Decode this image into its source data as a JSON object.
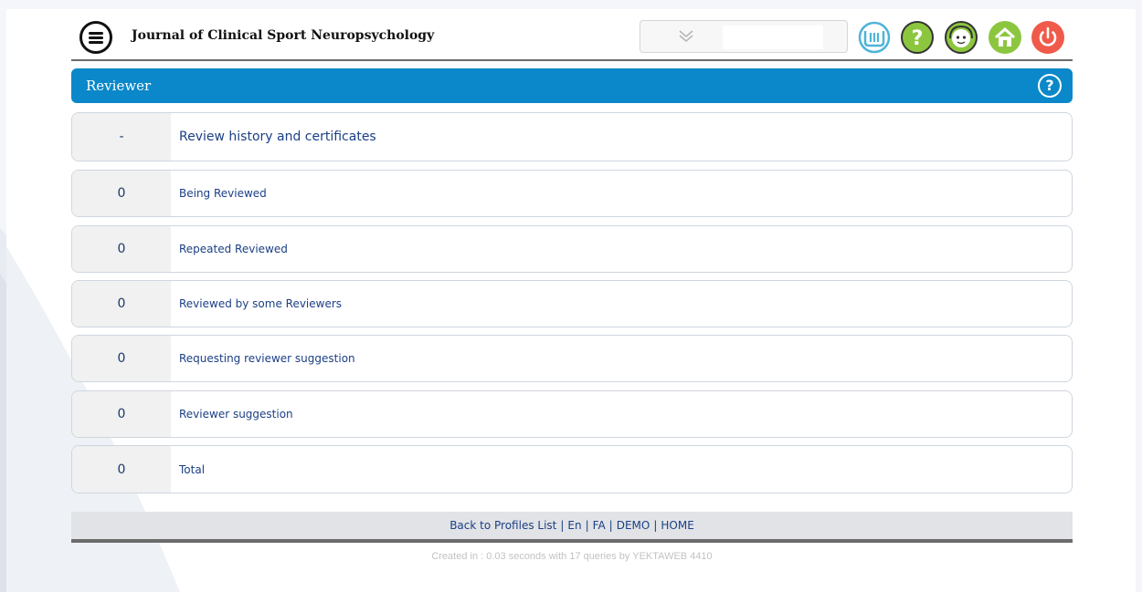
{
  "header": {
    "journal_title": "Journal of Clinical Sport Neuropsychology",
    "icons": [
      "menu-icon",
      "yektaweb-logo-icon",
      "help-icon",
      "support-icon",
      "home-icon",
      "power-icon"
    ]
  },
  "panel": {
    "title": "Reviewer",
    "help_glyph": "?"
  },
  "rows": [
    {
      "count": "-",
      "label": "Review history and certificates"
    },
    {
      "count": "0",
      "label": "Being Reviewed"
    },
    {
      "count": "0",
      "label": "Repeated Reviewed"
    },
    {
      "count": "0",
      "label": "Reviewed by some Reviewers"
    },
    {
      "count": "0",
      "label": "Requesting reviewer suggestion"
    },
    {
      "count": "0",
      "label": "Reviewer suggestion"
    },
    {
      "count": "0",
      "label": "Total"
    }
  ],
  "footer": {
    "links": [
      "Back to Profiles List",
      "En",
      "FA",
      "DEMO",
      "HOME"
    ],
    "separator": "|",
    "created": "Created in : 0.03 seconds with 17 queries by YEKTAWEB 4410"
  },
  "colors": {
    "accent": "#0a88c9",
    "link": "#1b3f85",
    "help_green": "#8cc63f",
    "power_red": "#f05a4a"
  }
}
